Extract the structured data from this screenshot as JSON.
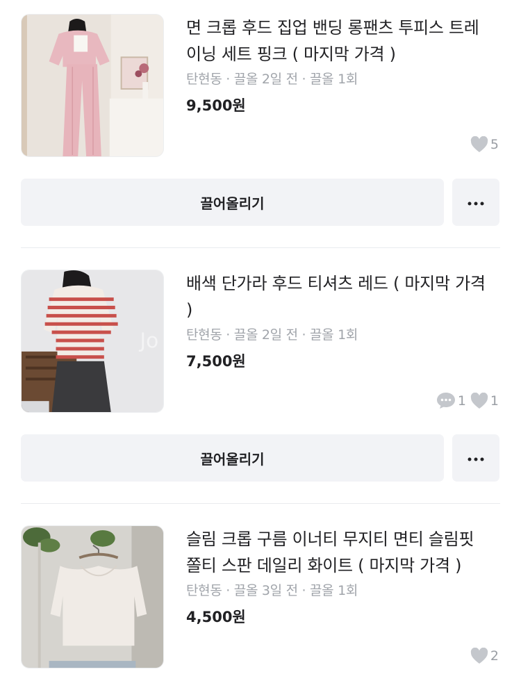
{
  "items": [
    {
      "title": "면 크롭 후드 집업 밴딩 롱팬츠 투피스 트레이닝 세트 핑크 ( 마지막 가격 )",
      "location": "탄현동",
      "bump_time": "끌올 2일 전",
      "bump_count": "끌올 1회",
      "price": "9,500원",
      "comments": "",
      "likes": "5",
      "bump_label": "끌어올리기"
    },
    {
      "title": "배색 단가라 후드 티셔츠 레드 ( 마지막 가격 )",
      "location": "탄현동",
      "bump_time": "끌올 2일 전",
      "bump_count": "끌올 1회",
      "price": "7,500원",
      "comments": "1",
      "likes": "1",
      "bump_label": "끌어올리기"
    },
    {
      "title": "슬림 크롭 구름 이너티 무지티 면티 슬림핏 쫄티 스판 데일리 화이트 ( 마지막 가격 )",
      "location": "탄현동",
      "bump_time": "끌올 3일 전",
      "bump_count": "끌올 1회",
      "price": "4,500원",
      "comments": "",
      "likes": "2"
    }
  ],
  "separator": " · ",
  "icons": {
    "like": "heart-icon",
    "comment": "chat-bubble-icon",
    "more": "more-horizontal-icon"
  },
  "colors": {
    "button_bg": "#f2f3f6",
    "meta_text": "#a0a4aa",
    "icon": "#c4c7cc"
  }
}
